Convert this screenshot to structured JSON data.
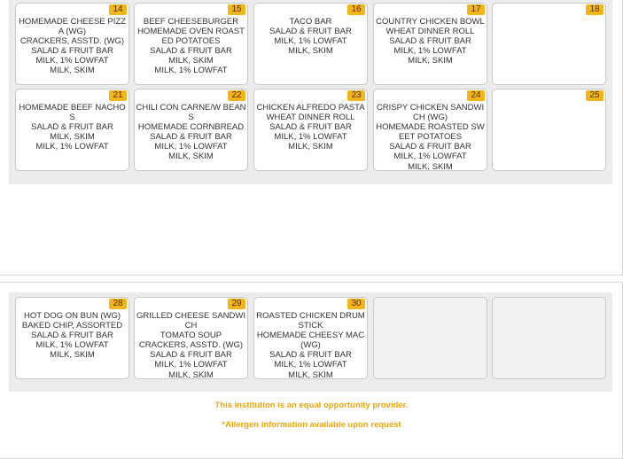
{
  "calendar": {
    "week3": [
      {
        "date": "14",
        "items": [
          "HOMEMADE CHEESE PIZZA (WG)",
          "CRACKERS, ASSTD. (WG)",
          "SALAD & FRUIT BAR",
          "MILK, 1% LOWFAT",
          "MILK, SKIM"
        ]
      },
      {
        "date": "15",
        "items": [
          "BEEF CHEESEBURGER",
          "HOMEMADE OVEN ROASTED POTATOES",
          "SALAD & FRUIT BAR",
          "MILK, SKIM",
          "MILK, 1% LOWFAT"
        ]
      },
      {
        "date": "16",
        "items": [
          "TACO BAR",
          "SALAD & FRUIT BAR",
          "MILK, 1% LOWFAT",
          "MILK, SKIM"
        ]
      },
      {
        "date": "17",
        "items": [
          "COUNTRY CHICKEN BOWL",
          "WHEAT DINNER ROLL",
          "SALAD & FRUIT BAR",
          "MILK, 1% LOWFAT",
          "MILK, SKIM"
        ]
      },
      {
        "date": "18",
        "items": []
      }
    ],
    "week4": [
      {
        "date": "21",
        "items": [
          "HOMEMADE BEEF NACHOS",
          "SALAD & FRUIT BAR",
          "MILK, SKIM",
          "MILK, 1% LOWFAT"
        ]
      },
      {
        "date": "22",
        "items": [
          "CHILI CON CARNE/W BEANS",
          "HOMEMADE CORNBREAD",
          "SALAD & FRUIT BAR",
          "MILK, 1% LOWFAT",
          "MILK, SKIM"
        ]
      },
      {
        "date": "23",
        "items": [
          "CHICKEN ALFREDO PASTA",
          "WHEAT DINNER ROLL",
          "SALAD & FRUIT BAR",
          "MILK, 1% LOWFAT",
          "MILK, SKIM"
        ]
      },
      {
        "date": "24",
        "items": [
          "CRISPY CHICKEN SANDWICH (WG)",
          "HOMEMADE ROASTED SWEET POTATOES",
          "SALAD & FRUIT BAR",
          "MILK, 1% LOWFAT",
          "MILK, SKIM"
        ]
      },
      {
        "date": "25",
        "items": []
      }
    ],
    "week5": [
      {
        "date": "28",
        "items": [
          "HOT DOG ON BUN (WG)",
          "BAKED CHIP, ASSORTED",
          "SALAD & FRUIT BAR",
          "MILK, 1% LOWFAT",
          "MILK, SKIM"
        ]
      },
      {
        "date": "29",
        "items": [
          "GRILLED CHEESE SANDWICH",
          "TOMATO SOUP",
          "CRACKERS, ASSTD. (WG)",
          "SALAD & FRUIT BAR",
          "MILK, 1% LOWFAT",
          "MILK, SKIM"
        ]
      },
      {
        "date": "30",
        "items": [
          "ROASTED CHICKEN DRUMSTICK",
          "HOMEMADE CHEESY MAC (WG)",
          "SALAD & FRUIT BAR",
          "MILK, 1% LOWFAT",
          "MILK, SKIM"
        ]
      },
      {
        "date": "",
        "items": []
      },
      {
        "date": "",
        "items": []
      }
    ]
  },
  "footer": {
    "equal_opportunity": "This institution is an equal opportunity provider.",
    "allergen": "*Allergen information available upon request"
  },
  "colors": {
    "date_badge": "#f5b418",
    "footer_text": "#f0a500",
    "grid_background": "#ececec"
  }
}
